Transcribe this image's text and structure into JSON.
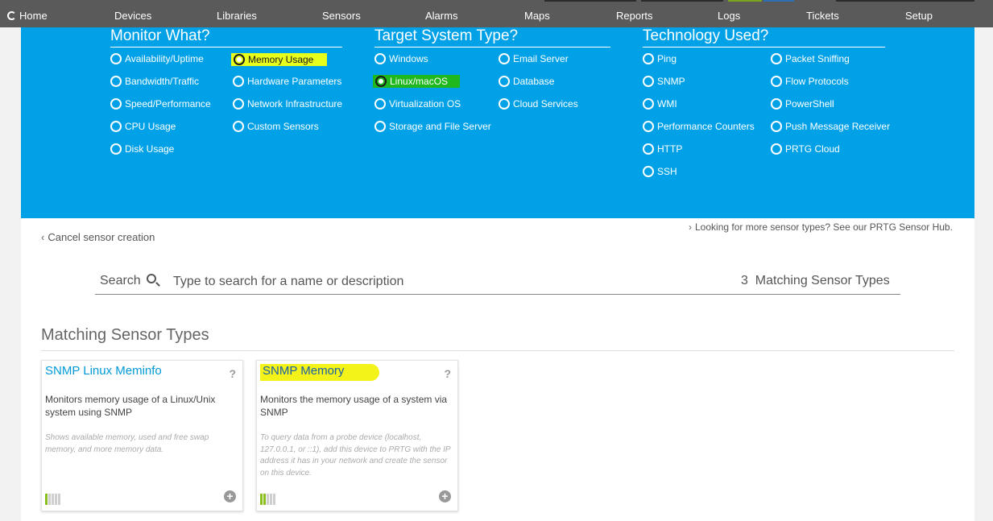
{
  "nav": {
    "home": "Home",
    "items": [
      "Devices",
      "Libraries",
      "Sensors",
      "Alarms",
      "Maps",
      "Reports",
      "Logs",
      "Tickets",
      "Setup"
    ]
  },
  "filters": {
    "monitor_what": {
      "title": "Monitor What?",
      "col1": [
        "Availability/Uptime",
        "Bandwidth/Traffic",
        "Speed/Performance",
        "CPU Usage",
        "Disk Usage"
      ],
      "col2": [
        "Memory Usage",
        "Hardware Parameters",
        "Network Infrastructure",
        "Custom Sensors"
      ],
      "selected": "Memory Usage"
    },
    "target_system": {
      "title": "Target System Type?",
      "col1": [
        "Windows",
        "Linux/macOS",
        "Virtualization OS",
        "Storage and File Server"
      ],
      "col2": [
        "Email Server",
        "Database",
        "Cloud Services"
      ],
      "selected": "Linux/macOS"
    },
    "technology": {
      "title": "Technology Used?",
      "col1": [
        "Ping",
        "SNMP",
        "WMI",
        "Performance Counters",
        "HTTP",
        "SSH"
      ],
      "col2": [
        "Packet Sniffing",
        "Flow Protocols",
        "PowerShell",
        "Push Message Receiver",
        "PRTG Cloud"
      ]
    },
    "highlight_colors": {
      "yellow": "#e8ff1c",
      "green": "#1fb81f"
    }
  },
  "actions": {
    "cancel": "Cancel sensor creation",
    "hub_link": "Looking for more sensor types? See our PRTG Sensor Hub."
  },
  "search": {
    "label": "Search",
    "placeholder": "Type to search for a name or description",
    "match_count": "3",
    "match_text": "Matching Sensor Types"
  },
  "results": {
    "title": "Matching Sensor Types",
    "cards": [
      {
        "title": "SNMP Linux Meminfo",
        "description": "Monitors memory usage of a Linux/Unix system using SNMP",
        "note": "Shows available memory, used and free swap memory, and more memory data.",
        "performance_level": 1,
        "performance_max": 5
      },
      {
        "title": "SNMP Memory",
        "description": "Monitors the memory usage of a system via SNMP",
        "note": "To query data from a probe device (localhost, 127.0.0.1, or ::1), add this device to PRTG with the IP address it has in your network and create the sensor on this device.",
        "performance_level": 2,
        "performance_max": 5
      }
    ]
  },
  "colors": {
    "panel_blue": "#00a1e6",
    "nav_bg": "#5a5a5a",
    "link_blue": "#0099d8"
  }
}
